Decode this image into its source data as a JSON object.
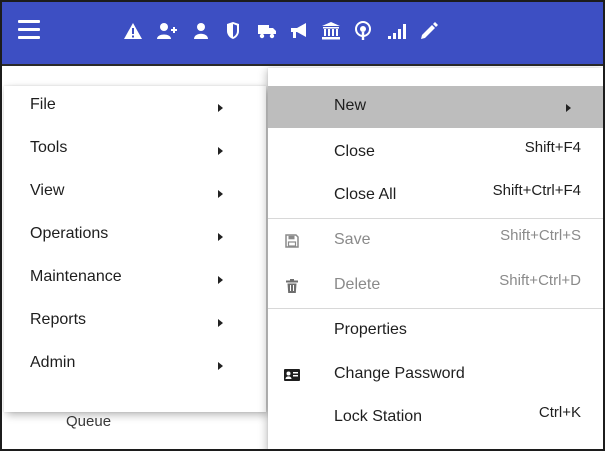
{
  "background": {
    "partial_text": "Queue"
  },
  "colors": {
    "app_bar": "#3d4fc3",
    "highlight": "#bdbdbd",
    "disabled_text": "#8a8a8a"
  },
  "toolbar": {
    "icons": [
      "alert-triangle-icon",
      "add-user-icon",
      "user-icon",
      "shield-icon",
      "truck-icon",
      "megaphone-icon",
      "bank-icon",
      "podcast-icon",
      "signal-icon",
      "pencil-icon"
    ]
  },
  "main_menu": {
    "items": [
      {
        "label": "File"
      },
      {
        "label": "Tools"
      },
      {
        "label": "View"
      },
      {
        "label": "Operations"
      },
      {
        "label": "Maintenance"
      },
      {
        "label": "Reports"
      },
      {
        "label": "Admin"
      }
    ]
  },
  "file_menu": {
    "new": {
      "label": "New"
    },
    "close": {
      "label": "Close",
      "shortcut": "Shift+F4"
    },
    "close_all": {
      "label": "Close All",
      "shortcut": "Shift+Ctrl+F4"
    },
    "save": {
      "label": "Save",
      "shortcut": "Shift+Ctrl+S",
      "icon": "save-icon"
    },
    "delete": {
      "label": "Delete",
      "shortcut": "Shift+Ctrl+D",
      "icon": "trash-icon"
    },
    "properties": {
      "label": "Properties"
    },
    "change_password": {
      "label": "Change Password",
      "icon": "id-card-icon"
    },
    "lock_station": {
      "label": "Lock Station",
      "shortcut": "Ctrl+K"
    }
  }
}
